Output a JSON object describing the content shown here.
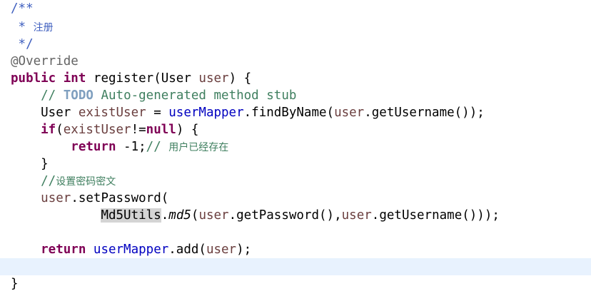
{
  "editor": {
    "language": "Java",
    "colors": {
      "keyword": "#7f0055",
      "comment": "#3f7f5f",
      "javadoc": "#3f5fbf",
      "todo": "#7f9fbf",
      "annotation": "#646464",
      "field": "#0000c0",
      "local_variable": "#6a3e3e",
      "current_line": "#e8f2fe",
      "occurrence_highlight": "#d4d4d4"
    },
    "tokens": {
      "l1_open": "/**",
      "l2_star": " * ",
      "l2_text": "注册",
      "l3_close": " */",
      "l4_annotation": "@Override",
      "l5_public": "public",
      "l5_sp1": " ",
      "l5_int": "int",
      "l5_mid": " register(User ",
      "l5_param": "user",
      "l5_end": ") {",
      "l6_slashes": "    // ",
      "l6_todo": "TODO",
      "l6_rest": " Auto-generated method stub",
      "l7_type": "    User ",
      "l7_var": "existUser",
      "l7_eq": " = ",
      "l7_field": "userMapper",
      "l7_call": ".findByName(",
      "l7_arg": "user",
      "l7_end": ".getUsername());",
      "l8_if": "    if",
      "l8_paren": "(",
      "l8_var": "existUser",
      "l8_neq": "!=",
      "l8_null": "null",
      "l8_end": ") {",
      "l9_return": "        return",
      "l9_val": " -1;",
      "l9_comment": "// ",
      "l9_comment_text": "用户已经存在",
      "l10_brace": "    }",
      "l11_comment": "    //",
      "l11_comment_text": "设置密码密文",
      "l12_indent": "    ",
      "l12_var": "user",
      "l12_call": ".setPassword(",
      "l13_indent": "            ",
      "l13_class": "Md5Utils",
      "l13_dot": ".",
      "l13_method": "md5",
      "l13_paren": "(",
      "l13_arg1": "user",
      "l13_mid": ".getPassword(),",
      "l13_arg2": "user",
      "l13_end": ".getUsername()));",
      "l15_return": "    return",
      "l15_sp": " ",
      "l15_field": "userMapper",
      "l15_call": ".add(",
      "l15_arg": "user",
      "l15_end": ");",
      "l17_brace": "}"
    }
  }
}
